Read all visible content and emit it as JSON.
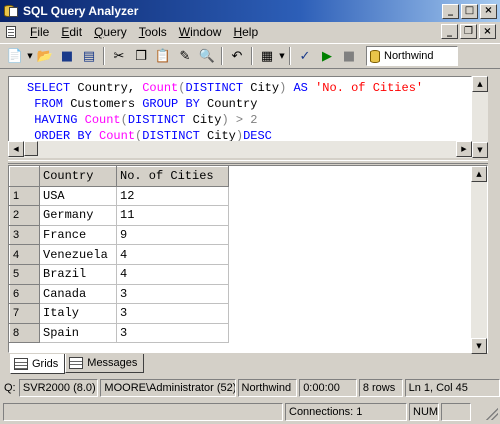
{
  "window": {
    "title": "SQL Query Analyzer"
  },
  "menu": {
    "items": [
      {
        "label": "File",
        "underline": "F",
        "rest": "ile"
      },
      {
        "label": "Edit",
        "underline": "E",
        "rest": "dit"
      },
      {
        "label": "Query",
        "underline": "Q",
        "rest": "uery"
      },
      {
        "label": "Tools",
        "underline": "T",
        "rest": "ools"
      },
      {
        "label": "Window",
        "underline": "W",
        "rest": "indow"
      },
      {
        "label": "Help",
        "underline": "H",
        "rest": "elp"
      }
    ]
  },
  "toolbar": {
    "database": "Northwind",
    "icons": [
      "new-query-icon",
      "open-icon",
      "save-icon",
      "import-icon",
      "cut-icon",
      "copy-icon",
      "paste-icon",
      "clear-icon",
      "find-icon",
      "undo-icon",
      "results-mode-icon",
      "check-syntax-icon",
      "execute-icon",
      "stop-icon"
    ]
  },
  "query": {
    "lines": [
      [
        {
          "t": "SELECT",
          "c": "kw"
        },
        {
          "t": " Country, ",
          "c": "idn"
        },
        {
          "t": "Count",
          "c": "fn"
        },
        {
          "t": "(",
          "c": "op"
        },
        {
          "t": "DISTINCT",
          "c": "kw"
        },
        {
          "t": " City",
          "c": "idn"
        },
        {
          "t": ")",
          "c": "op"
        },
        {
          "t": " AS ",
          "c": "kw"
        },
        {
          "t": "'No. of Cities'",
          "c": "str"
        }
      ],
      [
        {
          "t": " FROM",
          "c": "kw"
        },
        {
          "t": " Customers ",
          "c": "idn"
        },
        {
          "t": "GROUP BY",
          "c": "kw"
        },
        {
          "t": " Country",
          "c": "idn"
        }
      ],
      [
        {
          "t": " HAVING",
          "c": "kw"
        },
        {
          "t": " ",
          "c": "idn"
        },
        {
          "t": "Count",
          "c": "fn"
        },
        {
          "t": "(",
          "c": "op"
        },
        {
          "t": "DISTINCT",
          "c": "kw"
        },
        {
          "t": " City",
          "c": "idn"
        },
        {
          "t": ")",
          "c": "op"
        },
        {
          "t": " > 2",
          "c": "op"
        }
      ],
      [
        {
          "t": " ORDER BY",
          "c": "kw"
        },
        {
          "t": " ",
          "c": "idn"
        },
        {
          "t": "Count",
          "c": "fn"
        },
        {
          "t": "(",
          "c": "op"
        },
        {
          "t": "DISTINCT",
          "c": "kw"
        },
        {
          "t": " City",
          "c": "idn"
        },
        {
          "t": ")",
          "c": "op"
        },
        {
          "t": "DESC",
          "c": "kw"
        }
      ]
    ]
  },
  "results": {
    "columns": [
      "Country",
      "No. of Cities"
    ],
    "rows": [
      {
        "n": "1",
        "country": "USA",
        "cities": "12"
      },
      {
        "n": "2",
        "country": "Germany",
        "cities": "11"
      },
      {
        "n": "3",
        "country": "France",
        "cities": "9"
      },
      {
        "n": "4",
        "country": "Venezuela",
        "cities": "4"
      },
      {
        "n": "5",
        "country": "Brazil",
        "cities": "4"
      },
      {
        "n": "6",
        "country": "Canada",
        "cities": "3"
      },
      {
        "n": "7",
        "country": "Italy",
        "cities": "3"
      },
      {
        "n": "8",
        "country": "Spain",
        "cities": "3"
      }
    ]
  },
  "tabs": {
    "grids": "Grids",
    "messages": "Messages"
  },
  "status": {
    "prefix": "Q:",
    "server": "SVR2000 (8.0)",
    "user": "MOORE\\Administrator (52)",
    "database": "Northwind",
    "elapsed": "0:00:00",
    "rows": "8 rows",
    "position": "Ln 1, Col 45",
    "connections": "Connections: 1",
    "num": "NUM"
  }
}
